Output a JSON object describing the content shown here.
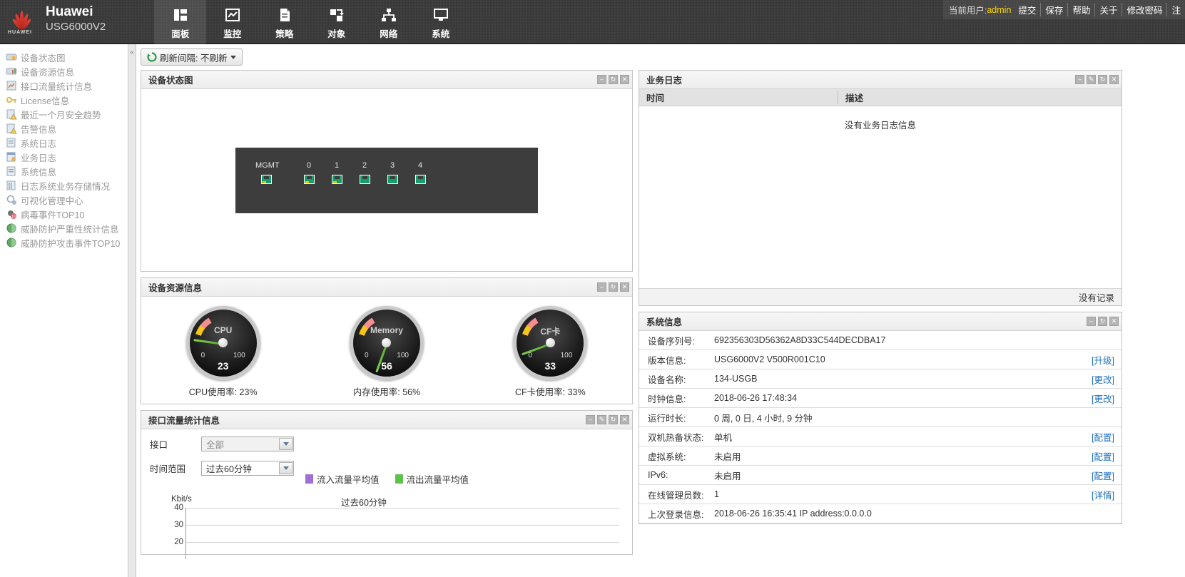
{
  "header": {
    "brand_name": "Huawei",
    "brand_model": "USG6000V2",
    "logo_text": "HUAWEI",
    "nav": [
      {
        "label": "面板",
        "icon": "panel-icon",
        "active": true
      },
      {
        "label": "监控",
        "icon": "monitor-icon",
        "active": false
      },
      {
        "label": "策略",
        "icon": "policy-icon",
        "active": false
      },
      {
        "label": "对象",
        "icon": "object-icon",
        "active": false
      },
      {
        "label": "网络",
        "icon": "network-icon",
        "active": false
      },
      {
        "label": "系统",
        "icon": "system-icon",
        "active": false
      }
    ],
    "user_label": "当前用户:",
    "user_name": "admin",
    "links": [
      "提交",
      "保存",
      "帮助",
      "关于",
      "修改密码",
      "注"
    ]
  },
  "sidebar": {
    "items": [
      {
        "label": "设备状态图",
        "icon": "device-status-icon"
      },
      {
        "label": "设备资源信息",
        "icon": "device-resource-icon"
      },
      {
        "label": "接口流量统计信息",
        "icon": "interface-traffic-icon"
      },
      {
        "label": "License信息",
        "icon": "license-key-icon"
      },
      {
        "label": "最近一个月安全趋势",
        "icon": "security-trend-icon"
      },
      {
        "label": "告警信息",
        "icon": "alarm-icon"
      },
      {
        "label": "系统日志",
        "icon": "system-log-icon"
      },
      {
        "label": "业务日志",
        "icon": "service-log-icon"
      },
      {
        "label": "系统信息",
        "icon": "system-info-icon"
      },
      {
        "label": "日志系统业务存储情况",
        "icon": "log-storage-icon"
      },
      {
        "label": "可视化管理中心",
        "icon": "visual-manage-icon"
      },
      {
        "label": "病毒事件TOP10",
        "icon": "virus-event-icon"
      },
      {
        "label": "威胁防护严重性统计信息",
        "icon": "threat-severity-icon"
      },
      {
        "label": "威胁防护攻击事件TOP10",
        "icon": "threat-attack-icon"
      }
    ]
  },
  "toolbar": {
    "refresh_label": "刷新间隔: 不刷新",
    "refresh_icon": "refresh-icon"
  },
  "panels": {
    "device_status": {
      "title": "设备状态图",
      "tools": [
        "minimize",
        "refresh",
        "close"
      ],
      "mgmt_label": "MGMT",
      "ports": [
        "0",
        "1",
        "2",
        "3",
        "4"
      ]
    },
    "device_resource": {
      "title": "设备资源信息",
      "tools": [
        "minimize",
        "refresh",
        "close"
      ],
      "gauges": [
        {
          "name": "CPU",
          "value": 23,
          "min_label": "0",
          "max_label": "100",
          "caption": "CPU使用率: 23%"
        },
        {
          "name": "Memory",
          "value": 56,
          "min_label": "0",
          "max_label": "100",
          "caption": "内存使用率: 56%"
        },
        {
          "name": "CF卡",
          "value": 33,
          "min_label": "0",
          "max_label": "100",
          "caption": "CF卡使用率: 33%"
        }
      ]
    },
    "interface_traffic": {
      "title": "接口流量统计信息",
      "tools": [
        "minimize",
        "edit",
        "refresh",
        "close"
      ],
      "interface_label": "接口",
      "interface_value": "全部",
      "timerange_label": "时间范围",
      "timerange_value": "过去60分钟",
      "legend": [
        {
          "label": "流入流量平均值",
          "color": "#a06fd6"
        },
        {
          "label": "流出流量平均值",
          "color": "#5cc24a"
        }
      ]
    },
    "service_log": {
      "title": "业务日志",
      "tools": [
        "minimize",
        "edit",
        "refresh",
        "close"
      ],
      "columns": [
        "时间",
        "描述"
      ],
      "empty_text": "没有业务日志信息",
      "footer_text": "没有记录"
    },
    "system_info": {
      "title": "系统信息",
      "tools": [
        "minimize",
        "refresh",
        "close"
      ],
      "rows": [
        {
          "key": "设备序列号:",
          "value": "692356303D56362A8D33C544DECDBA17",
          "action": ""
        },
        {
          "key": "版本信息:",
          "value": "USG6000V2 V500R001C10",
          "action": "[升级]"
        },
        {
          "key": "设备名称:",
          "value": "134-USGB",
          "action": "[更改]"
        },
        {
          "key": "时钟信息:",
          "value": "2018-06-26 17:48:34",
          "action": "[更改]"
        },
        {
          "key": "运行时长:",
          "value": "0 周, 0 日, 4 小时, 9 分钟",
          "action": ""
        },
        {
          "key": "双机热备状态:",
          "value": "单机",
          "action": "[配置]"
        },
        {
          "key": "虚拟系统:",
          "value": "未启用",
          "action": "[配置]"
        },
        {
          "key": "IPv6:",
          "value": "未启用",
          "action": "[配置]"
        },
        {
          "key": "在线管理员数:",
          "value": "1",
          "action": "[详情]"
        },
        {
          "key": "上次登录信息:",
          "value": "2018-06-26 16:35:41 IP address:0.0.0.0",
          "action": ""
        }
      ]
    }
  },
  "chart_data": {
    "type": "line",
    "title": "过去60分钟",
    "ylabel": "Kbit/s",
    "xlabel": "",
    "yticks": [
      40,
      30,
      20
    ],
    "ylim": [
      20,
      40
    ],
    "grid": true,
    "legend_position": "top",
    "series": [
      {
        "name": "流入流量平均值",
        "color": "#a06fd6",
        "values": []
      },
      {
        "name": "流出流量平均值",
        "color": "#5cc24a",
        "values": []
      }
    ]
  }
}
